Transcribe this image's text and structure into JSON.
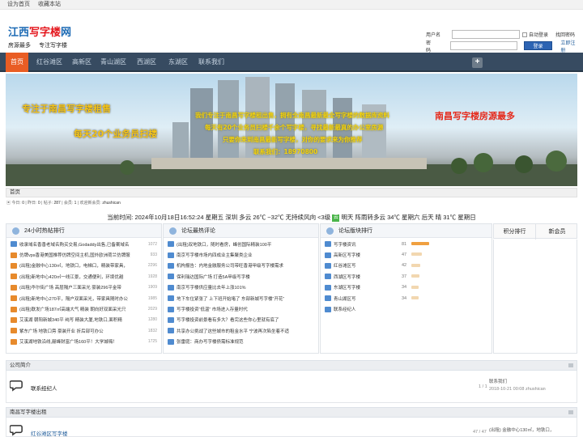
{
  "topbar": {
    "links": [
      "设为首页",
      "收藏本站"
    ]
  },
  "logo": {
    "title_blue": "江西",
    "title_red": "写字楼",
    "title_end": "网",
    "tagline1": "房源最多",
    "tagline2": "专注写字楼"
  },
  "login": {
    "username_label": "用户名",
    "password_label": "密码",
    "auto_login": "自动登录",
    "forgot": "找回密码",
    "submit": "登录",
    "register": "立即注册"
  },
  "nav": {
    "items": [
      "首页",
      "红谷滩区",
      "高新区",
      "青山湖区",
      "西湖区",
      "东湖区",
      "联系我们"
    ],
    "plus": "+"
  },
  "banner": {
    "left1": "专注于南昌写字楼租售",
    "left2": "每天20个业务员扫楼",
    "right1": "南昌写字楼房源最多",
    "center1": "我们专注于南昌写字楼租出售，拥有全南昌最新最全写字楼的数据库资料",
    "center2": "每天有20个业务员扫楼千余个写字楼，寻找最新最真的办公室房源",
    "center3": "只要你来到南昌最新写字楼，对你的要求来为你推荐",
    "center4": "联系我们：18970800"
  },
  "breadcrumb": {
    "home": "首页"
  },
  "stats": {
    "today_label": "今日:",
    "today": "0",
    "yesterday_label": "昨日:",
    "yesterday": "0",
    "posts_label": "帖子:",
    "posts": "287",
    "members_label": "会员:",
    "members": "1",
    "welcome_label": "欢迎新会员:",
    "newest": "zhushican"
  },
  "weather": {
    "text": "当前时间: 2024年10月18日16:52:24 星期五   深圳 多云  26℃ ~32℃  无持续风向 <3级",
    "icon_text": "云",
    "forecast": "明天  阵雨转多云 34℃  星期六  后天  晴 31℃  星期日"
  },
  "hot_posts": {
    "title": "24小时热帖排行",
    "items": [
      {
        "text": "收录域名香香老域名购买交易,Godaddy出售,已备案域名",
        "count": "1072"
      },
      {
        "text": "仿牌vps香港美国推荐仿牌空间主机,国外欧洲荷兰仿牌服",
        "count": "933"
      },
      {
        "text": "(出租)金融中心130㎡，地铁口，电梯口，精装带家具，",
        "count": "2296"
      },
      {
        "text": "(出租)新地中心420㎡一线江景，交通便利，环境优越",
        "count": "1928"
      },
      {
        "text": "(出租)华尔街广场 高层隔户三面采光 豪装296平金带",
        "count": "1909"
      },
      {
        "text": "(出租)新地中心270平，隔户双面采光，带家具随时办公",
        "count": "1985"
      },
      {
        "text": "(出租)联发广场187㎡高端大气 精装 朝向好双面采光只",
        "count": "2029"
      },
      {
        "text": "艾溪湖 朝阳新城340平 纯写 精装大厦,地铁口,面积精",
        "count": "1280"
      },
      {
        "text": "紫东广场 地铁口旁 豪装开业 折后部可办公",
        "count": "1832"
      },
      {
        "text": "艾溪湖地铁沿线,巅峰财富广场160平！大学城嗨！",
        "count": "1725"
      }
    ]
  },
  "hot_comments": {
    "title": "论坛最热评论",
    "items": [
      "(出租)双地铁口，随时看房，峰创国际精装100平",
      "南京写字楼市场内四成业主集聚类企业",
      "机构报告：内地金融服务公司带旺香港甲级写字楼需求",
      "保利瑞达国际广场 打造5A甲级写字楼",
      "南京写字楼供应量比去年上涨101%",
      "地下车位紧张了 上下班开始堵了 东部新城写字楼“开花”",
      "写字楼投资“低温” 市场进入存量时代",
      "写字楼投资前景看有多大？看完这些你心里就有底了",
      "共享办公挑战了这些城市的租金水平 宁波再次陷坐着不适",
      "张雷庭：商办写字楼债需标准规范"
    ]
  },
  "board_rank": {
    "title": "论坛版块排行",
    "items": [
      {
        "name": "写字楼资讯",
        "count": "81",
        "level": 100
      },
      {
        "name": "高新区写字楼",
        "count": "47",
        "level": 58
      },
      {
        "name": "红谷滩区写",
        "count": "42",
        "level": 52
      },
      {
        "name": "西湖区写字楼",
        "count": "37",
        "level": 46
      },
      {
        "name": "东湖区写字楼",
        "count": "34",
        "level": 42
      },
      {
        "name": "青山湖区写",
        "count": "34",
        "level": 42
      },
      {
        "name": "联系经纪人",
        "count": "",
        "level": 0
      }
    ]
  },
  "side_tabs": [
    "积分排行",
    "新会员"
  ],
  "section1": {
    "title": "公司简介",
    "forum_name": "联系经纪人",
    "count": "1 / 1",
    "last_title": "联系我们",
    "last_meta": "2018-10-21 00:08 zhushican"
  },
  "section2": {
    "title": "南昌写字楼出租",
    "forum_name": "红谷滩区写字楼",
    "count": "47 / 47",
    "last_title": "(出租) 金融中心130㎡，地铁口，"
  },
  "colors": {
    "nav_bg": "#374b61",
    "nav_active": "#e95d24",
    "accent_blue": "#2d64b3"
  }
}
